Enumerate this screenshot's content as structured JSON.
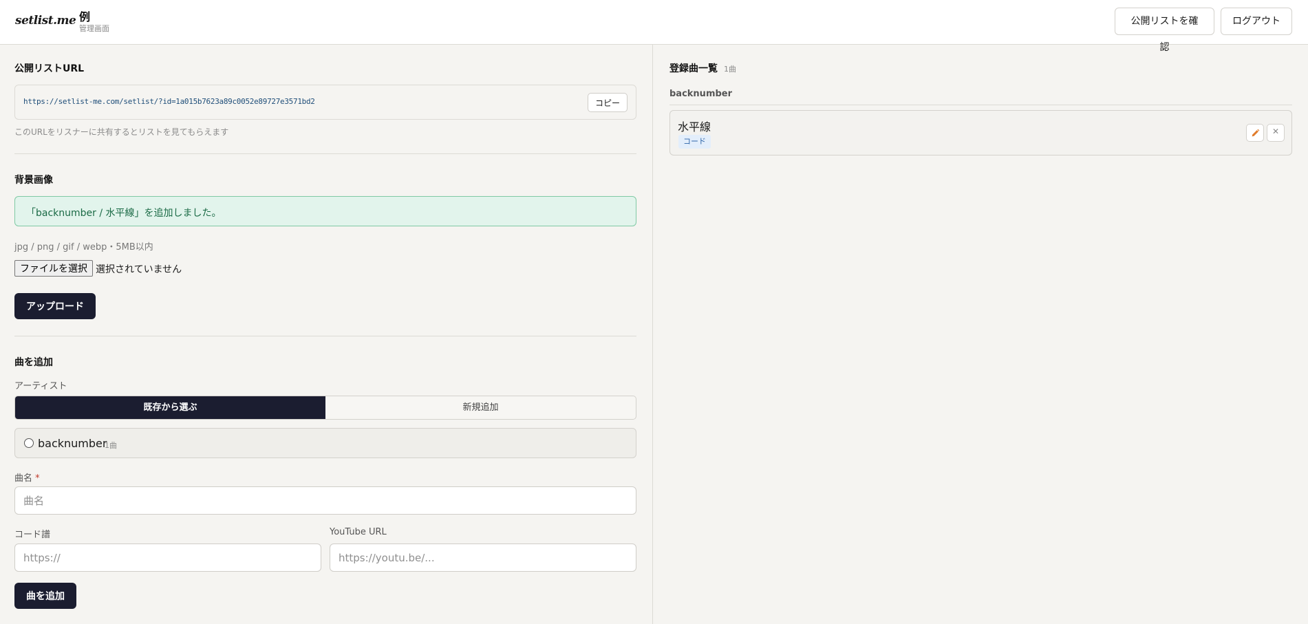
{
  "header": {
    "logo": "setlist.me",
    "title": "例",
    "subtitle": "管理画面",
    "public_list_label": "公開リストを確認",
    "logout_label": "ログアウト"
  },
  "public_url": {
    "section_title": "公開リストURL",
    "url": "https://setlist-me.com/setlist/?id=1a015b7623a89c0052e89727e3571bd2",
    "copy_label": "コピー",
    "hint": "このURLをリスナーに共有するとリストを見てもらえます"
  },
  "background": {
    "section_title": "背景画像",
    "notice": "「backnumber / 水平線」を追加しました。",
    "formats": "jpg / png / gif / webp・5MB以内",
    "file_button": "ファイルを選択",
    "file_status": "選択されていません",
    "upload_label": "アップロード"
  },
  "add_song": {
    "section_title": "曲を追加",
    "artist_label": "アーティスト",
    "tab_existing": "既存から選ぶ",
    "tab_new": "新規追加",
    "artist_option": {
      "name": "backnumber",
      "count": "1曲"
    },
    "song_name_label": "曲名",
    "required_mark": "*",
    "song_name_placeholder": "曲名",
    "chord_label": "コード譜",
    "chord_placeholder": "https://",
    "youtube_label": "YouTube URL",
    "youtube_placeholder": "https://youtu.be/...",
    "submit_label": "曲を追加"
  },
  "song_list": {
    "title": "登録曲一覧",
    "count": "1曲",
    "groups": [
      {
        "artist": "backnumber",
        "songs": [
          {
            "title": "水平線",
            "tag": "コード"
          }
        ]
      }
    ]
  },
  "colors": {
    "primary_dark": "#1b1d30",
    "success_bg": "#e2f4ec",
    "success_border": "#7fc9a4",
    "edit_icon": "#e07b2a"
  },
  "icons": {
    "edit": "pencil-icon",
    "delete": "close-icon",
    "radio": "radio-unchecked-icon"
  }
}
